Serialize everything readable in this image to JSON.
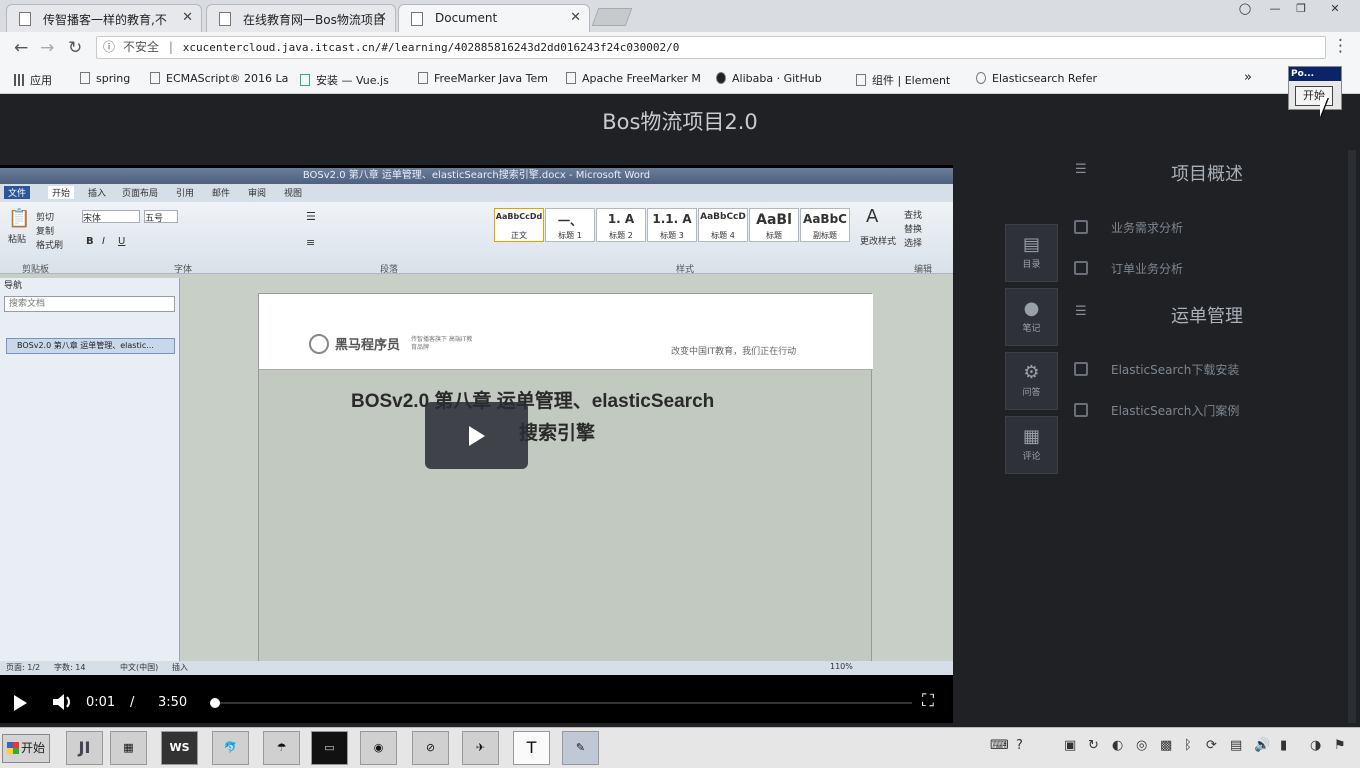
{
  "browser": {
    "tabs": [
      {
        "title": "传智播客一样的教育,不"
      },
      {
        "title": "在线教育网一Bos物流项目"
      },
      {
        "title": "Document"
      }
    ],
    "address": {
      "security": "不安全",
      "url": "xcucentercloud.java.itcast.cn/#/learning/402885816243d2dd016243f24c030002/0"
    },
    "bookmarks": [
      {
        "label": "应用"
      },
      {
        "label": "spring"
      },
      {
        "label": "ECMAScript® 2016 La"
      },
      {
        "label": "安装 — Vue.js"
      },
      {
        "label": "FreeMarker Java Tem"
      },
      {
        "label": "Apache FreeMarker M"
      },
      {
        "label": "Alibaba · GitHub"
      },
      {
        "label": "组件 | Element"
      },
      {
        "label": "Elasticsearch Refer"
      }
    ],
    "more": "»"
  },
  "popup": {
    "title": "Po...",
    "button": "开始"
  },
  "page": {
    "header_title": "Bos物流项目2.0"
  },
  "word": {
    "title": "BOSv2.0 第八章 运单管理、elasticSearch搜索引擎.docx - Microsoft Word",
    "ribbon_tabs": [
      "文件",
      "开始",
      "插入",
      "页面布局",
      "引用",
      "邮件",
      "审阅",
      "视图"
    ],
    "clipboard": {
      "paste": "粘贴",
      "cut": "剪切",
      "copy": "复制",
      "painter": "格式刷",
      "group": "剪贴板"
    },
    "font": {
      "name": "宋体",
      "size": "五号",
      "group": "字体"
    },
    "paragraph_group": "段落",
    "styles": [
      {
        "preview": "AaBbCcDd",
        "name": "正文"
      },
      {
        "preview": "一、",
        "name": "标题 1"
      },
      {
        "preview": "1. A",
        "name": "标题 2"
      },
      {
        "preview": "1.1. A",
        "name": "标题 3"
      },
      {
        "preview": "AaBbCcD",
        "name": "标题 4"
      },
      {
        "preview": "AaBl",
        "name": "标题"
      },
      {
        "preview": "AaBbC",
        "name": "副标题"
      }
    ],
    "styles_group": "样式",
    "change_styles": "更改样式",
    "edit": {
      "find": "查找",
      "replace": "替换",
      "select": "选择",
      "group": "编辑"
    },
    "nav": {
      "title": "导航",
      "search_placeholder": "搜索文档",
      "item": "BOSv2.0 第八章 运单管理、elastic..."
    },
    "doc": {
      "brand": "黑马程序员",
      "brand_sub": "传智播客旗下 高端IT教育品牌",
      "slogan": "改变中国IT教育，我们正在行动",
      "heading_line1": "BOSv2.0 第八章 运单管理、elasticSearch",
      "heading_line2": "搜索引擎"
    },
    "status": {
      "page": "页面: 1/2",
      "words": "字数: 14",
      "lang": "中文(中国)",
      "mode": "插入",
      "zoom": "110%"
    }
  },
  "player": {
    "current": "0:01",
    "sep": "/",
    "duration": "3:50",
    "progress": 0.004
  },
  "sidebar": {
    "buttons": [
      {
        "label": "目录"
      },
      {
        "label": "笔记"
      },
      {
        "label": "问答"
      },
      {
        "label": "评论"
      }
    ],
    "sections": [
      {
        "title": "项目概述",
        "items": [
          "业务需求分析",
          "订单业务分析"
        ]
      },
      {
        "title": "运单管理",
        "items": [
          "ElasticSearch下载安装",
          "ElasticSearch入门案例"
        ]
      }
    ]
  },
  "taskbar": {
    "start": "开始",
    "apps": [
      "JI",
      "WS",
      "T"
    ]
  }
}
